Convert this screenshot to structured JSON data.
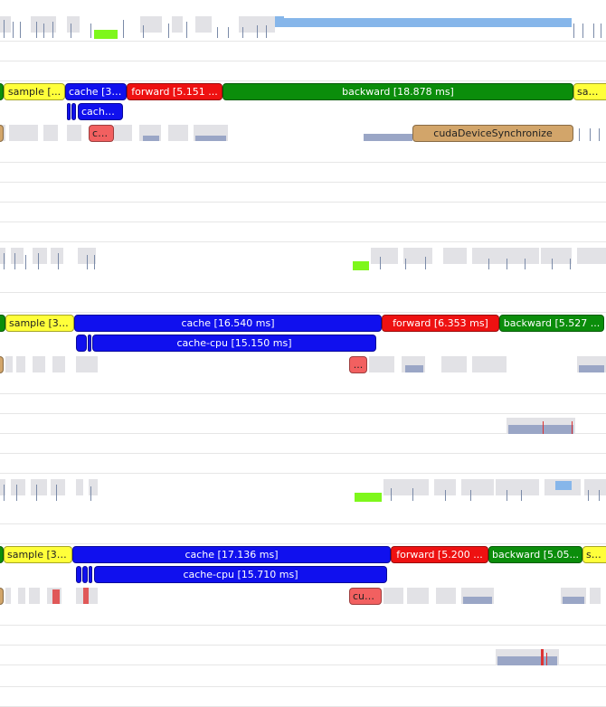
{
  "colors": {
    "sample": "#ffff3a",
    "cache": "#1010ee",
    "forward": "#ee1111",
    "backward": "#0b8d0b",
    "sync": "#d2a56a",
    "kernel": "#f26060",
    "marker": "#7ef71b",
    "gpu_activity": "#86b6ea"
  },
  "step1": {
    "sample": "sample [...",
    "cache": "cache [3....",
    "forward": "forward [5.151 ...",
    "backward": "backward [18.878 ms]",
    "sample_next": "sampl",
    "cache_cpu": "cache...",
    "kernel": "cu...",
    "sync": "cudaDeviceSynchronize"
  },
  "step2": {
    "sample": "sample [3....",
    "cache": "cache [16.540 ms]",
    "forward": "forward [6.353 ms]",
    "backward": "backward [5.527 ...",
    "cache_cpu": "cache-cpu [15.150 ms]",
    "kernel": "..."
  },
  "step3": {
    "sample": "sample [3....",
    "cache": "cache [17.136 ms]",
    "forward": "forward [5.200 ...",
    "backward": "backward [5.05...",
    "sample_next": "sam",
    "cache_cpu": "cache-cpu [15.710 ms]",
    "kernel": "cud..."
  }
}
